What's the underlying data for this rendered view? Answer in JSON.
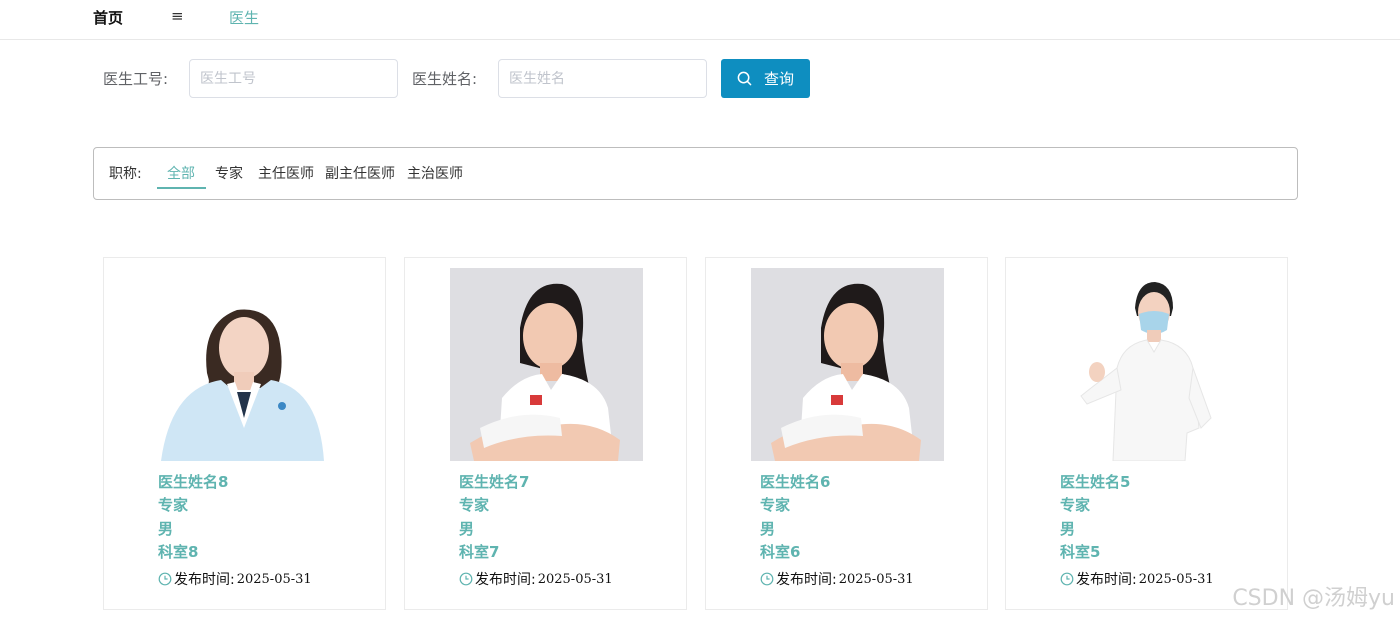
{
  "nav": {
    "home": "首页",
    "menu": "≡",
    "doctor": "医生"
  },
  "search": {
    "id_label": "医生工号:",
    "id_placeholder": "医生工号",
    "name_label": "医生姓名:",
    "name_placeholder": "医生姓名",
    "button": "查询"
  },
  "filter": {
    "label": "职称:",
    "tabs": [
      "全部",
      "专家",
      "主任医师",
      "副主任医师",
      "主治医师"
    ],
    "active": "全部"
  },
  "cards": [
    {
      "name": "医生姓名8",
      "title": "专家",
      "gender": "男",
      "dept": "科室8",
      "pub_label": "发布时间:",
      "date": "2025-05-31",
      "photo": "doctor-woman-long-hair"
    },
    {
      "name": "医生姓名7",
      "title": "专家",
      "gender": "男",
      "dept": "科室7",
      "pub_label": "发布时间:",
      "date": "2025-05-31",
      "photo": "doctor-woman-arms-crossed"
    },
    {
      "name": "医生姓名6",
      "title": "专家",
      "gender": "男",
      "dept": "科室6",
      "pub_label": "发布时间:",
      "date": "2025-05-31",
      "photo": "doctor-woman-arms-crossed"
    },
    {
      "name": "医生姓名5",
      "title": "专家",
      "gender": "男",
      "dept": "科室5",
      "pub_label": "发布时间:",
      "date": "2025-05-31",
      "photo": "doctor-woman-mask-thumbs-up"
    }
  ],
  "watermark": "CSDN @汤姆yu",
  "colors": {
    "accent": "#5fb4b0",
    "button": "#0e8ec0"
  }
}
